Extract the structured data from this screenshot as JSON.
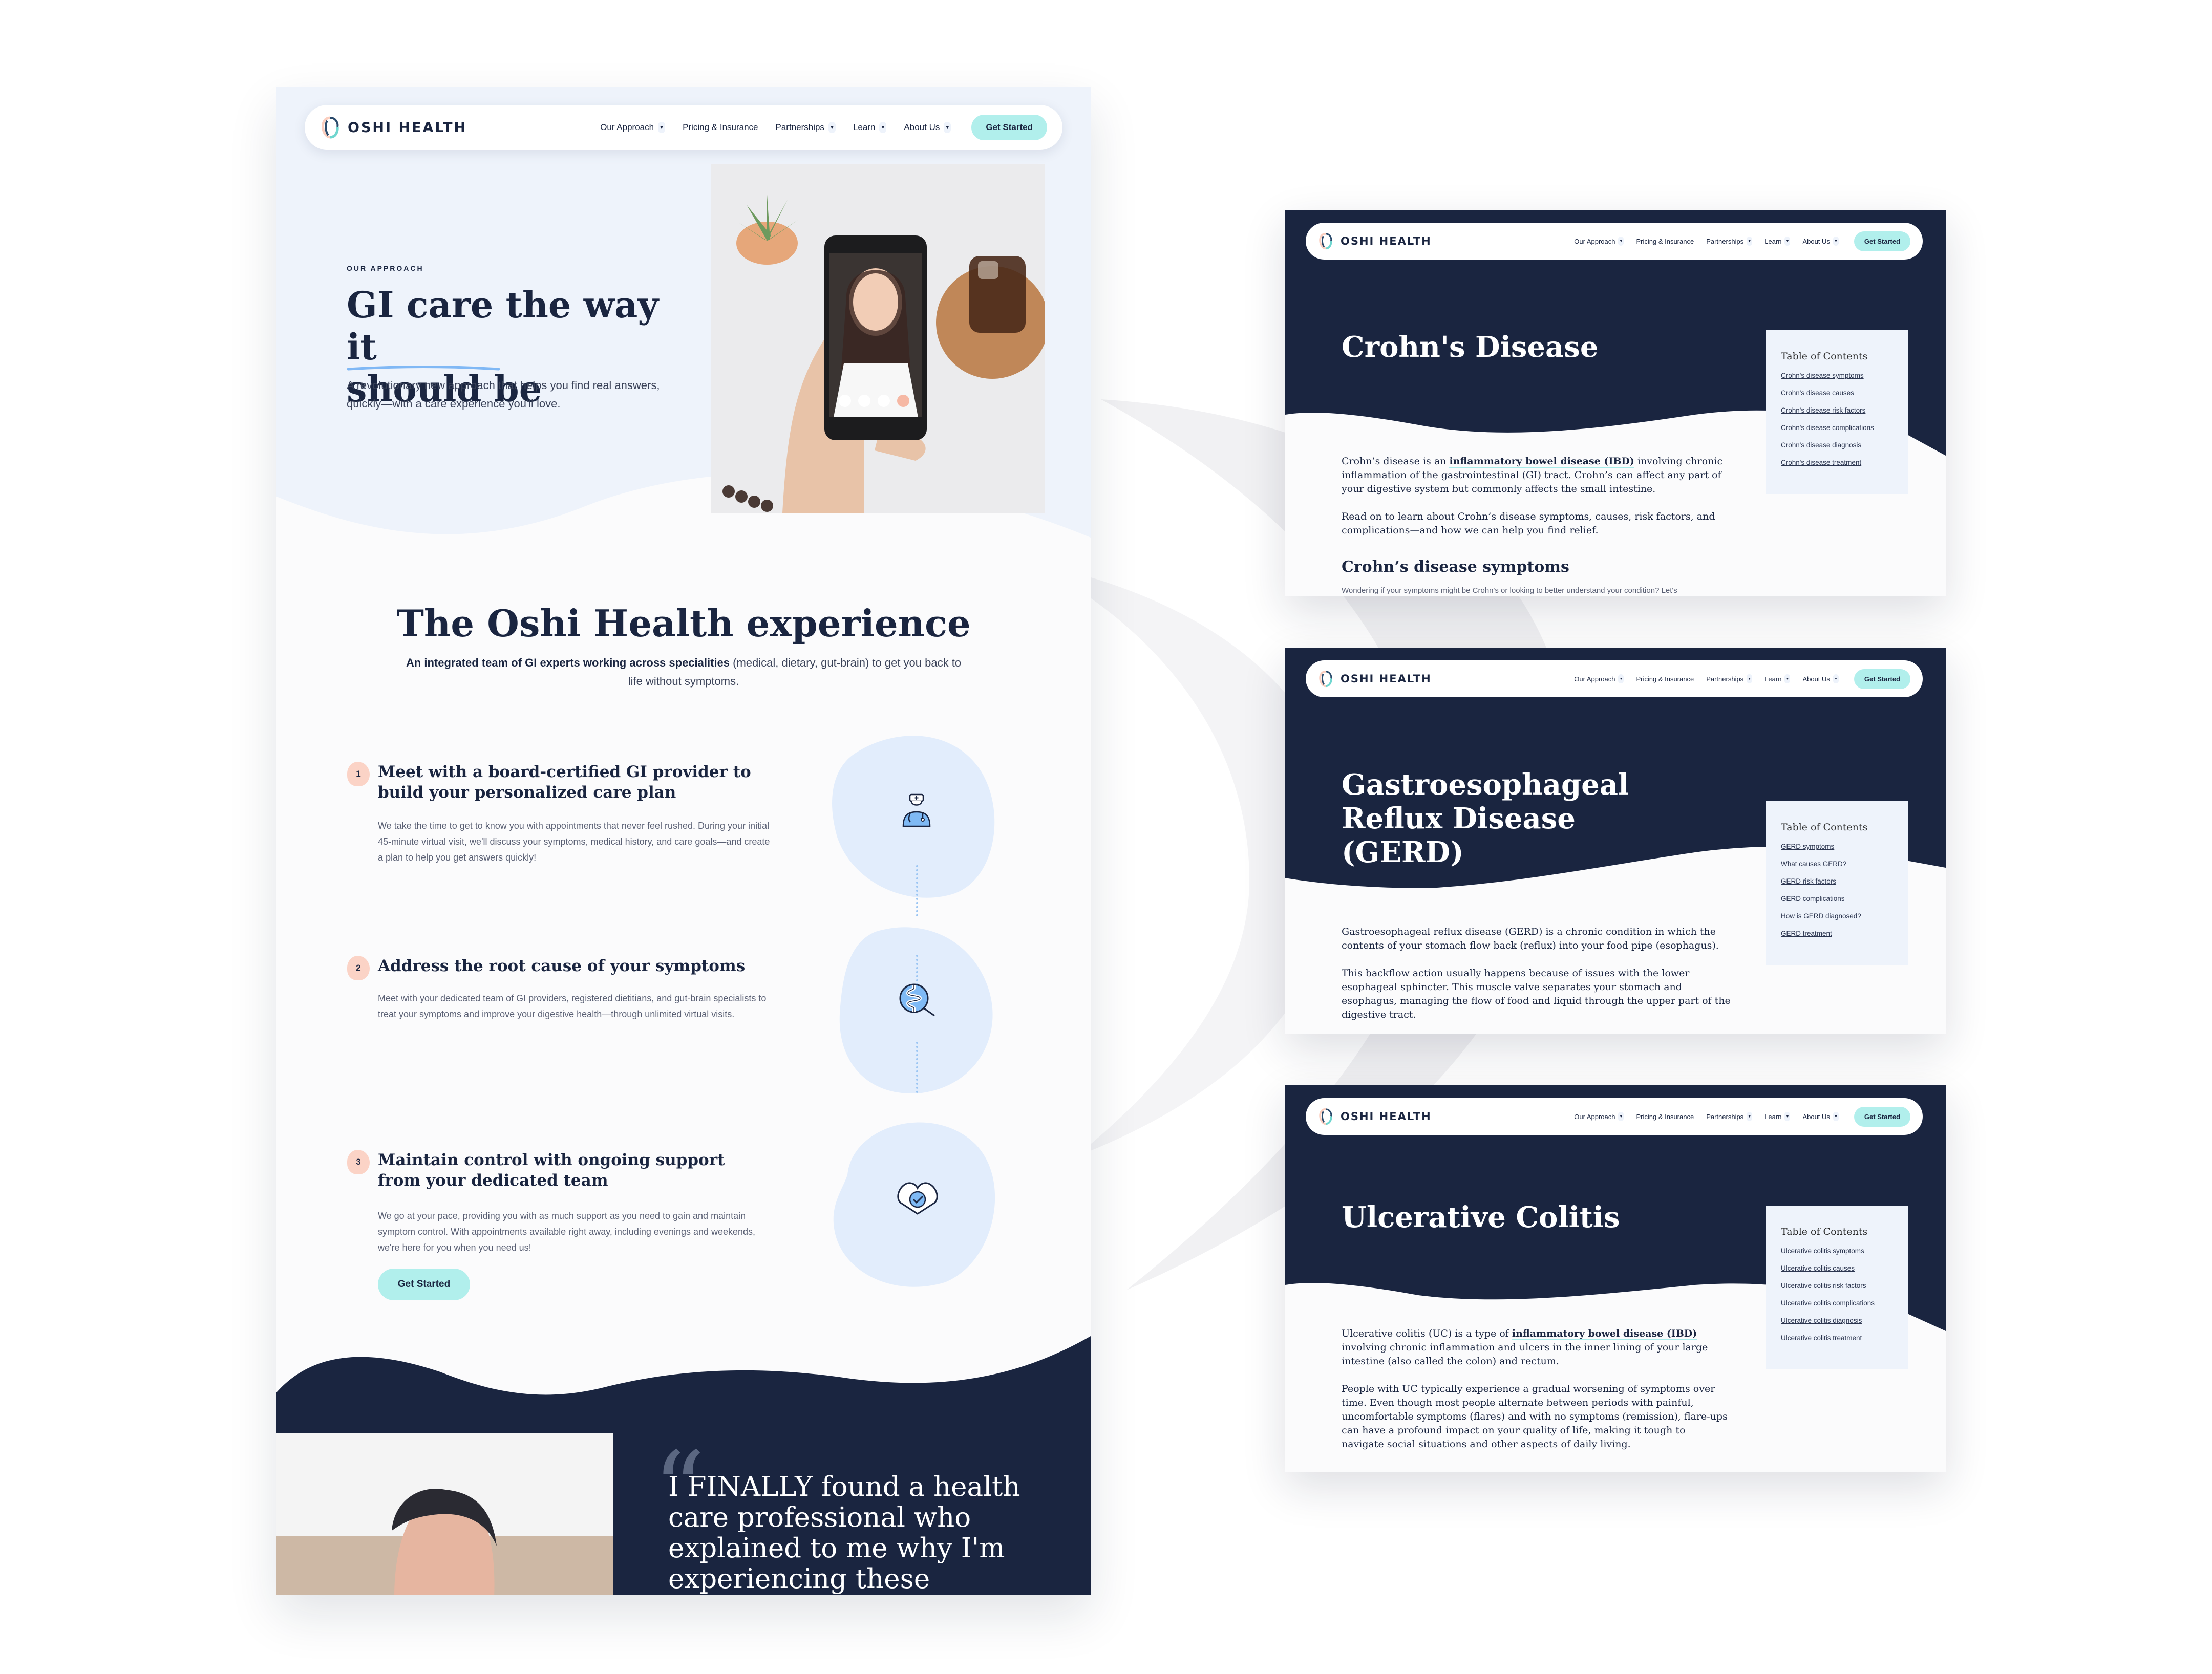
{
  "brand": {
    "name": "OSHI HEALTH",
    "colors": {
      "navy": "#1a2540",
      "accent_teal": "#b1efec",
      "light_blue": "#eef3fb",
      "blob_blue": "#e2edfc",
      "icon_blue": "#7fbaf5",
      "step_badge": "#fbd3c6"
    }
  },
  "nav": {
    "items": [
      {
        "label": "Our Approach",
        "has_dropdown": true
      },
      {
        "label": "Pricing & Insurance",
        "has_dropdown": false
      },
      {
        "label": "Partnerships",
        "has_dropdown": true
      },
      {
        "label": "Learn",
        "has_dropdown": true
      },
      {
        "label": "About Us",
        "has_dropdown": true
      }
    ],
    "cta_label": "Get Started"
  },
  "landing": {
    "hero": {
      "eyebrow": "OUR APPROACH",
      "title_line1": "GI care the way it",
      "title_line2": "should be",
      "subtitle": "A revolutionary new approach that helps you find real answers, quickly—with a care experience you'll love.",
      "photo_alt": "Patient holding phone on a video call with a doctor"
    },
    "experience": {
      "title": "The Oshi Health experience",
      "subtitle_bold": "An integrated team of GI experts working across specialities",
      "subtitle_rest": " (medical, dietary, gut-brain) to get you back to life without symptoms.",
      "steps": [
        {
          "number": "1",
          "title": "Meet with a board-certified GI provider to build your personalized care plan",
          "body": "We take the time to get to know you with appointments that never feel rushed. During your initial 45-minute virtual visit, we'll discuss your symptoms, medical history, and care goals—and create a plan to help you get answers quickly!",
          "icon": "doctor-icon"
        },
        {
          "number": "2",
          "title": "Address the root cause of your symptoms",
          "body": "Meet with your dedicated team of GI providers, registered dietitians, and gut-brain specialists to treat your symptoms and improve your digestive health—through unlimited virtual visits.",
          "icon": "intestine-search-icon"
        },
        {
          "number": "3",
          "title": "Maintain control with ongoing support from your dedicated team",
          "body": "We go at your pace, providing you with as much support as you need to gain and maintain symptom control. With appointments available right away, including evenings and weekends, we're here for you when you need us!",
          "icon": "heart-check-icon"
        }
      ],
      "cta_label": "Get Started"
    },
    "testimonial": {
      "quote_mark": "“",
      "text": "I FINALLY found a health care professional who explained to me why I'm experiencing these symptoms, in addition to"
    }
  },
  "panels": [
    {
      "title": "Crohn's Disease",
      "toc_title": "Table of Contents",
      "toc": [
        "Crohn's disease symptoms",
        "Crohn's disease causes",
        "Crohn's disease risk factors",
        "Crohn's disease complications",
        "Crohn's disease diagnosis",
        "Crohn's disease treatment"
      ],
      "p1_pre": "Crohn’s disease is an ",
      "p1_link": "inflammatory bowel disease (IBD)",
      "p1_post": " involving chronic inflammation of the gastrointestinal (GI) tract. Crohn’s can affect any part of your digestive system but commonly affects the small intestine.",
      "p2": "Read on to learn about Crohn’s disease symptoms, causes, risk factors, and complications—and how we can help you find relief.",
      "h2": "Crohn’s disease symptoms",
      "p3": "Wondering if your symptoms might be Crohn's or looking to better understand your condition? Let's"
    },
    {
      "title": "Gastroesophageal Reflux Disease (GERD)",
      "toc_title": "Table of Contents",
      "toc": [
        "GERD symptoms",
        "What causes GERD?",
        "GERD risk factors",
        "GERD complications",
        "How is GERD diagnosed?",
        "GERD treatment"
      ],
      "p1": "Gastroesophageal reflux disease (GERD) is a chronic condition in which the contents of your stomach flow back (reflux) into your food pipe (esophagus).",
      "p2": "This backflow action usually happens because of issues with the lower esophageal sphincter. This muscle valve separates your stomach and esophagus, managing the flow of food and liquid through the upper part of the digestive tract."
    },
    {
      "title": "Ulcerative Colitis",
      "toc_title": "Table of Contents",
      "toc": [
        "Ulcerative colitis symptoms",
        "Ulcerative colitis causes",
        "Ulcerative colitis risk factors",
        "Ulcerative colitis complications",
        "Ulcerative colitis diagnosis",
        "Ulcerative colitis treatment"
      ],
      "p1_pre": "Ulcerative colitis (UC) is a type of ",
      "p1_link": "inflammatory bowel disease (IBD)",
      "p1_post": " involving chronic inflammation and ulcers in the inner lining of your large intestine (also called the colon) and rectum.",
      "p2": "People with UC typically experience a gradual worsening of symptoms over time. Even though most people alternate between periods with painful, uncomfortable symptoms (flares) and with no symptoms (remission), flare-ups can have a profound impact on your quality of life, making it tough to navigate social situations and other aspects of daily living."
    }
  ]
}
